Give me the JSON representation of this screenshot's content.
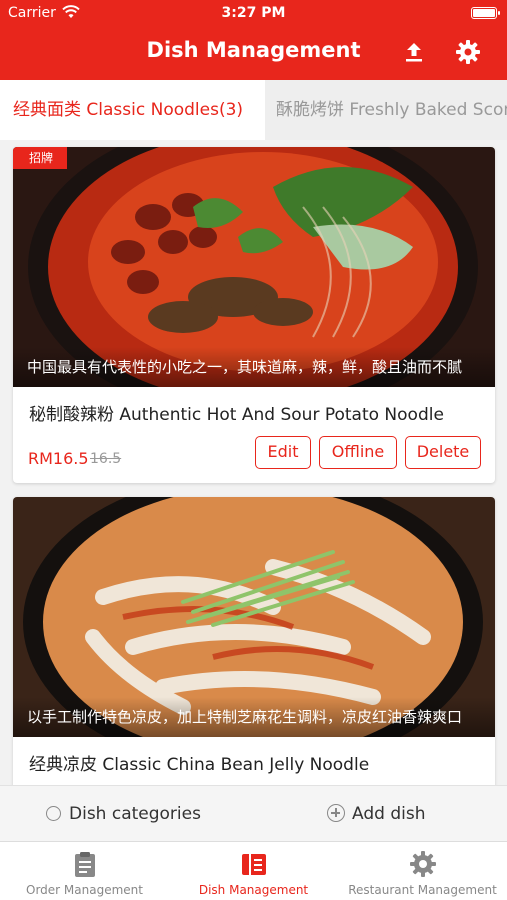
{
  "status_bar": {
    "carrier": "Carrier",
    "time": "3:27 PM"
  },
  "header": {
    "title": "Dish Management",
    "upload_icon": "upload-icon",
    "settings_icon": "gear-icon"
  },
  "category_tabs": [
    {
      "label": "经典面类 Classic Noodles(3)",
      "active": true
    },
    {
      "label": "酥脆烤饼 Freshly Baked Scones",
      "active": false
    }
  ],
  "dishes": [
    {
      "badge": "招牌",
      "description": "中国最具有代表性的小吃之一，其味道麻，辣，鲜，酸且油而不腻",
      "name": "秘制酸辣粉 Authentic Hot And Sour Potato Noodle",
      "price": "RM16.5",
      "original_price": "16.5",
      "buttons": {
        "edit": "Edit",
        "offline": "Offline",
        "delete": "Delete"
      }
    },
    {
      "description": "以手工制作特色凉皮，加上特制芝麻花生调料，凉皮红油香辣爽口",
      "name": "经典凉皮 Classic China Bean Jelly Noodle"
    }
  ],
  "bottom_actions": {
    "categories": "Dish categories",
    "add": "Add dish"
  },
  "tab_bar": [
    {
      "label": "Order Management",
      "icon": "clipboard-icon"
    },
    {
      "label": "Dish Management",
      "icon": "book-icon",
      "active": true
    },
    {
      "label": "Restaurant Management",
      "icon": "gear-icon"
    }
  ],
  "colors": {
    "brand_red": "#e8261c",
    "inactive_gray": "#888888"
  }
}
